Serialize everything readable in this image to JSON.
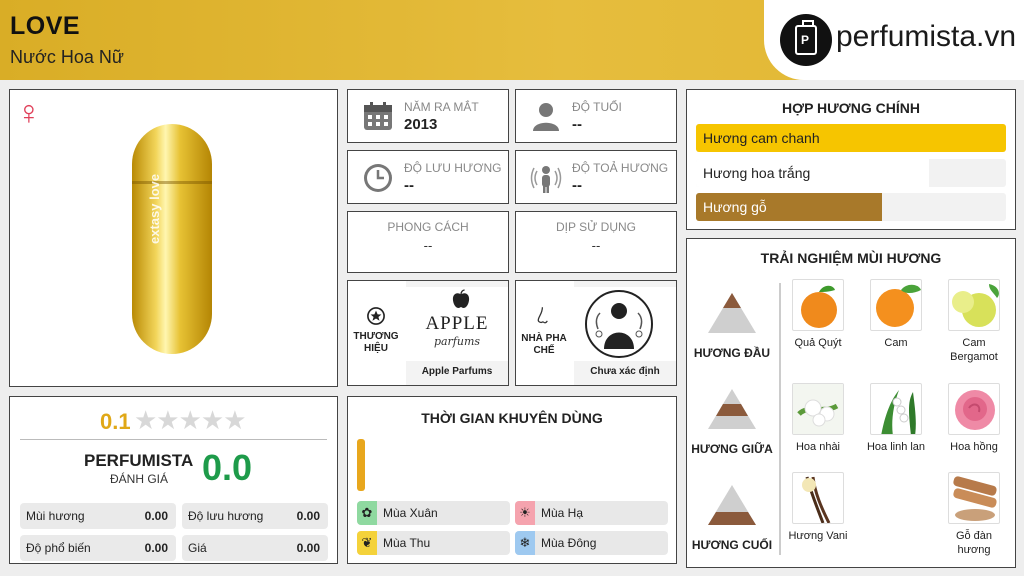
{
  "header": {
    "title": "LOVE",
    "subtitle": "Nước Hoa Nữ",
    "site": "perfumista.vn",
    "background": "#dcb02c"
  },
  "product": {
    "bottle_text": "extasy love"
  },
  "info": {
    "release": {
      "label": "NĂM RA MẮT",
      "value": "2013",
      "icon": "calendar-icon"
    },
    "age": {
      "label": "ĐỘ TUỔI",
      "value": "--",
      "icon": "person-icon"
    },
    "longevity": {
      "label": "ĐỘ LƯU HƯƠNG",
      "value": "--",
      "icon": "clock-icon"
    },
    "sillage": {
      "label": "ĐỘ TOẢ HƯƠNG",
      "value": "--",
      "icon": "radiating-person-icon"
    },
    "style": {
      "label": "PHONG CÁCH",
      "value": "--"
    },
    "occasion": {
      "label": "DỊP SỬ DỤNG",
      "value": "--"
    },
    "brand": {
      "label": "THƯƠNG HIỆU",
      "logo_top": "APPLE",
      "logo_bottom": "parfums",
      "name": "Apple Parfums"
    },
    "perfumer": {
      "label": "NHÀ PHA CHẾ",
      "name": "Chưa xác định"
    }
  },
  "rating": {
    "value": "0.1",
    "stars": "★★★★★",
    "perfumista_label": "PERFUMISTA",
    "perfumista_sub": "ĐÁNH GIÁ",
    "perfumista_score": "0.0",
    "stats": [
      {
        "label": "Mùi hương",
        "value": "0.00"
      },
      {
        "label": "Độ lưu hương",
        "value": "0.00"
      },
      {
        "label": "Độ phổ biến",
        "value": "0.00"
      },
      {
        "label": "Giá",
        "value": "0.00"
      }
    ]
  },
  "time": {
    "title": "THỜI GIAN KHUYÊN DÙNG",
    "seasons": [
      {
        "label": "Mùa Xuân",
        "icon": "flower-icon",
        "color": "#8fd9a0"
      },
      {
        "label": "Mùa Hạ",
        "icon": "sun-icon",
        "color": "#f5a3ae"
      },
      {
        "label": "Mùa Thu",
        "icon": "leaf-icon",
        "color": "#f4d23b"
      },
      {
        "label": "Mùa Đông",
        "icon": "snowflake-icon",
        "color": "#9ec9f0"
      }
    ]
  },
  "accords": {
    "title": "HỢP HƯƠNG CHÍNH",
    "items": [
      {
        "label": "Hương cam chanh",
        "level": 1.0,
        "color": "#f6c500",
        "text_color": "#222222"
      },
      {
        "label": "Hương hoa trắng",
        "level": 0.75,
        "color": "#ffffff",
        "text_color": "#222222"
      },
      {
        "label": "Hương gỗ",
        "level": 0.6,
        "color": "#a8792a",
        "text_color": "#ffffff"
      }
    ]
  },
  "notes": {
    "title": "TRẢI NGHIỆM MÙI HƯƠNG",
    "tiers": [
      {
        "label": "HƯƠNG ĐẦU",
        "icon": "top-note-pyramid-icon"
      },
      {
        "label": "HƯƠNG GIỮA",
        "icon": "middle-note-pyramid-icon"
      },
      {
        "label": "HƯƠNG CUỐI",
        "icon": "base-note-pyramid-icon"
      }
    ],
    "top": [
      {
        "name": "Quả Quýt",
        "icon": "mandarin-icon"
      },
      {
        "name": "Cam",
        "icon": "orange-icon"
      },
      {
        "name": "Cam Bergamot",
        "icon": "bergamot-icon"
      }
    ],
    "middle": [
      {
        "name": "Hoa nhài",
        "icon": "jasmine-icon"
      },
      {
        "name": "Hoa linh lan",
        "icon": "lily-of-the-valley-icon"
      },
      {
        "name": "Hoa hồng",
        "icon": "rose-icon"
      }
    ],
    "base": [
      {
        "name": "Hương Vani",
        "icon": "vanilla-icon"
      },
      {
        "name": "Gỗ đàn hương",
        "icon": "sandalwood-icon"
      }
    ]
  }
}
